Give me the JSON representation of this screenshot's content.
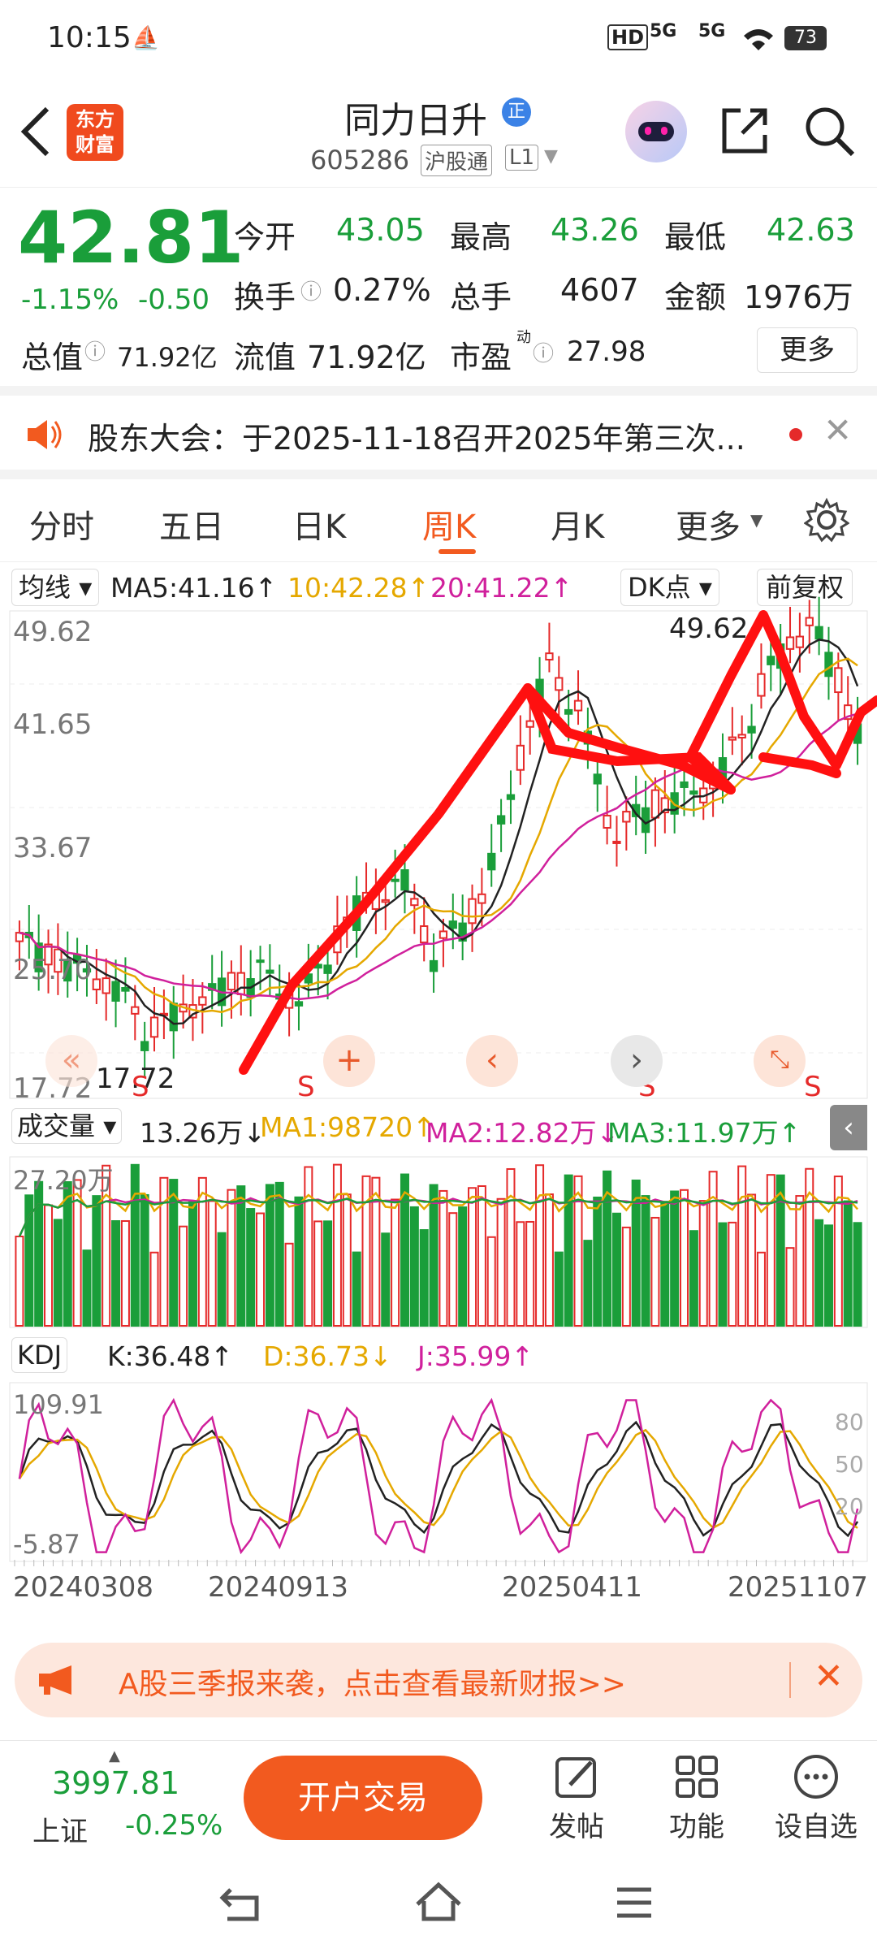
{
  "status": {
    "time": "10:15",
    "battery": "73",
    "net1": "5G",
    "net2": "5G",
    "hd": "HD"
  },
  "header": {
    "title": "同力日升",
    "badge": "正",
    "code": "605286",
    "market": "沪股通",
    "level": "L1",
    "logo_line1": "东方",
    "logo_line2": "财富"
  },
  "quote": {
    "price": "42.81",
    "change_pct": "-1.15%",
    "change": "-0.50",
    "open_label": "今开",
    "open": "43.05",
    "high_label": "最高",
    "high": "43.26",
    "low_label": "最低",
    "low": "42.63",
    "turnover_label": "换手",
    "turnover": "0.27%",
    "volume_label": "总手",
    "volume": "4607",
    "amount_label": "金额",
    "amount": "1976万",
    "mcap_label": "总值",
    "mcap": "71.92亿",
    "float_label": "流值",
    "float": "71.92亿",
    "pe_label": "市盈",
    "pe_sup": "动",
    "pe": "27.98",
    "more": "更多"
  },
  "notice": {
    "text": "股东大会：于2025-11-18召开2025年第三次..."
  },
  "tabs": [
    "分时",
    "五日",
    "日K",
    "周K",
    "月K",
    "更多"
  ],
  "active_tab": "周K",
  "chart": {
    "ma_select": "均线",
    "ma5": "MA5:41.16↑",
    "ma10": "10:42.28↑",
    "ma20": "20:41.22↑",
    "dk": "DK点",
    "fq": "前复权",
    "y_ticks": [
      "49.62",
      "41.65",
      "33.67",
      "25.70",
      "17.72"
    ],
    "max_label": "49.62",
    "min_label": "17.72",
    "vol_select": "成交量",
    "vol": "13.26万↓",
    "vma1": "MA1:98720↑",
    "vma2": "MA2:12.82万↓",
    "vma3": "MA3:11.97万↑",
    "vol_max": "27.20万",
    "kdj_select": "KDJ",
    "k": "K:36.48↑",
    "d": "D:36.73↓",
    "j": "J:35.99↑",
    "kdj_top": "109.91",
    "kdj_bottom": "-5.87",
    "kdj_ref": [
      "80",
      "50",
      "20"
    ],
    "dates": [
      "20240308",
      "20240913",
      "20250411",
      "20251107"
    ],
    "signals": [
      "S",
      "S",
      "S",
      "S"
    ],
    "tool_icons": [
      "zoom-in-icon",
      "chevron-left-icon",
      "chevron-right-icon",
      "expand-icon"
    ]
  },
  "chart_data": {
    "type": "candlestick",
    "title": "",
    "x": [
      "20240308",
      "20240913",
      "20250411",
      "20251107"
    ],
    "ylim": [
      17.72,
      49.62
    ],
    "last_close": 42.81,
    "high": 49.62,
    "low": 17.72
  },
  "ad": {
    "text": "A股三季报来袭，点击查看最新财报>>"
  },
  "bottom": {
    "index_value": "3997.81",
    "index_name": "上证",
    "index_change": "-0.25%",
    "trade_btn": "开户交易",
    "post": "发帖",
    "func": "功能",
    "watch": "设自选"
  },
  "colors": {
    "up": "#e52a2a",
    "down": "#1a9e3a",
    "accent": "#f25a1f"
  }
}
